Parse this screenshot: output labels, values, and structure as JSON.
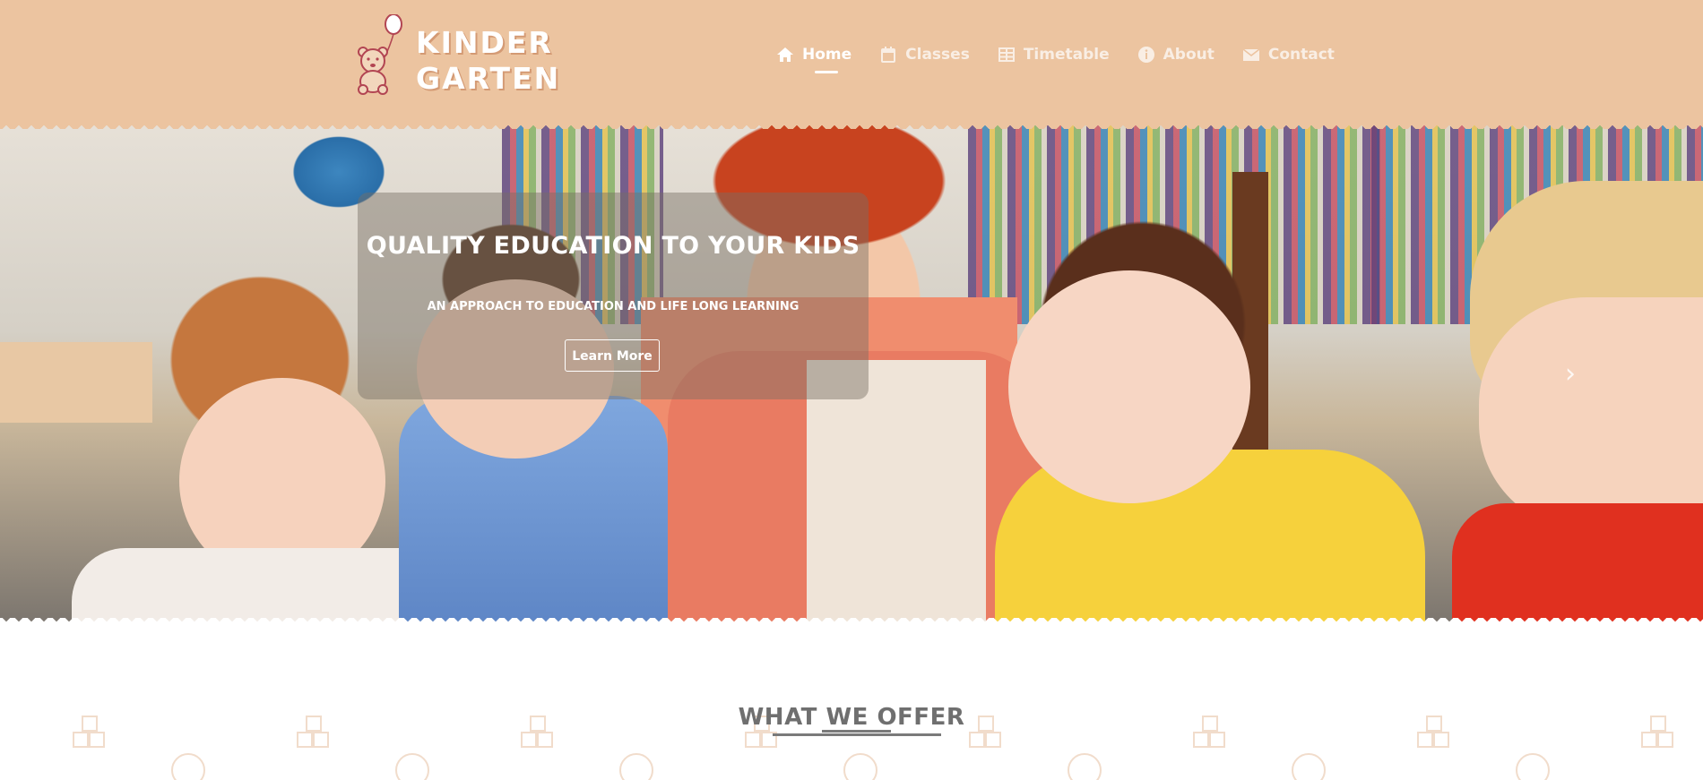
{
  "brand": {
    "line1": "KINDER",
    "line2": "GARTEN"
  },
  "nav": [
    {
      "label": "Home",
      "icon": "home-icon",
      "active": true
    },
    {
      "label": "Classes",
      "icon": "calendar-icon",
      "active": false
    },
    {
      "label": "Timetable",
      "icon": "table-icon",
      "active": false
    },
    {
      "label": "About",
      "icon": "info-icon",
      "active": false
    },
    {
      "label": "Contact",
      "icon": "envelope-icon",
      "active": false
    }
  ],
  "hero": {
    "headline": "QUALITY EDUCATION TO YOUR KIDS",
    "subheadline": "AN APPROACH TO EDUCATION AND LIFE LONG LEARNING",
    "cta": "Learn More"
  },
  "offer": {
    "title": "WHAT WE OFFER"
  },
  "colors": {
    "header_bg": "#ecc4a0",
    "pattern": "#f1dccb",
    "title": "#6f6f6f"
  }
}
